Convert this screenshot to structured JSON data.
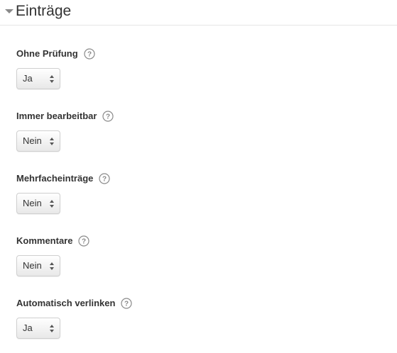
{
  "section": {
    "title": "Einträge",
    "collapse_icon": "caret-down-icon"
  },
  "help_icon": "question-circle-icon",
  "fields": [
    {
      "label": "Ohne Prüfung",
      "value": "Ja"
    },
    {
      "label": "Immer bearbeitbar",
      "value": "Nein"
    },
    {
      "label": "Mehrfacheinträge",
      "value": "Nein"
    },
    {
      "label": "Kommentare",
      "value": "Nein"
    },
    {
      "label": "Automatisch verlinken",
      "value": "Ja"
    }
  ],
  "colors": {
    "text": "#333333",
    "divider": "#e5e5e5",
    "icon": "#8a8a8a"
  }
}
